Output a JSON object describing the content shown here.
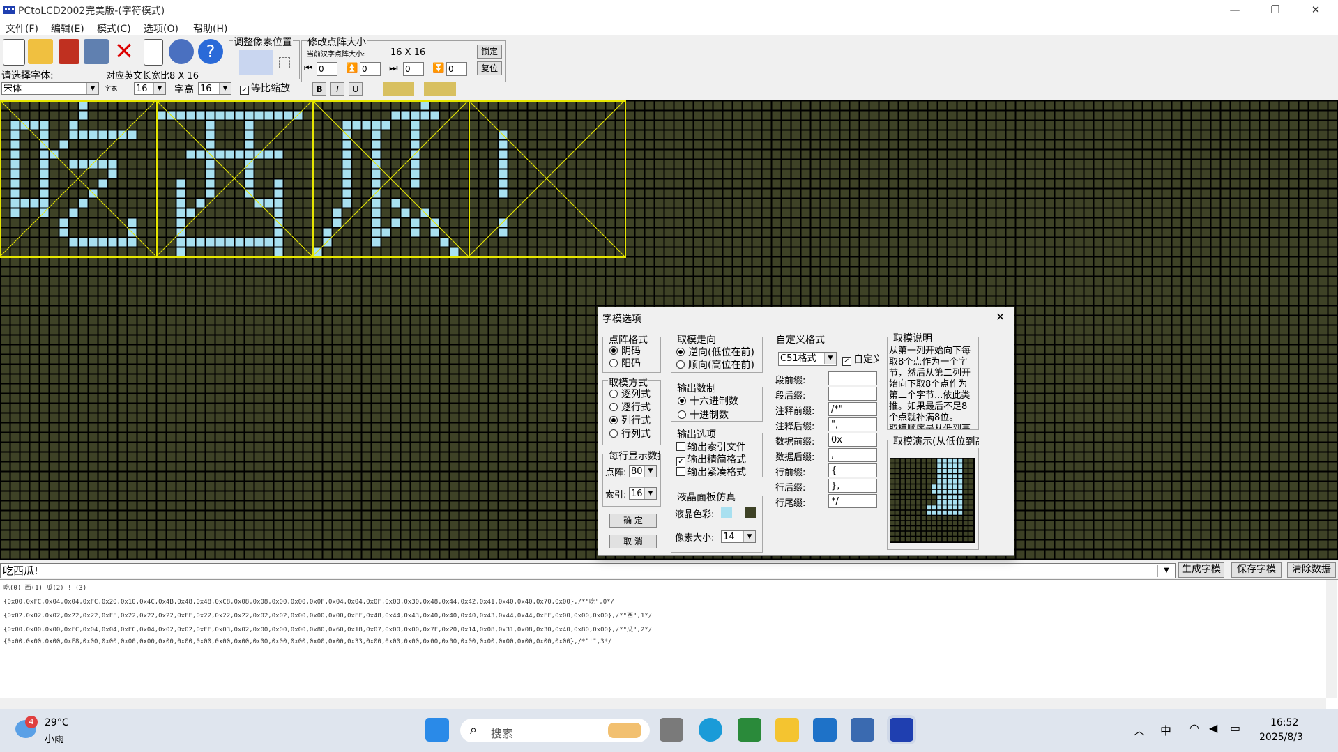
{
  "window": {
    "title": "PCtoLCD2002完美版-(字符模式)",
    "minimize": "—",
    "maximize": "❐",
    "close": "✕"
  },
  "menu": [
    "文件(F)",
    "编辑(E)",
    "模式(C)",
    "选项(O)",
    "帮助(H)"
  ],
  "toolbar": {
    "font_prompt": "请选择字体:",
    "font_value": "宋体",
    "ascii_ratio_label": "对应英文长宽比8 X 16",
    "width_label": "字宽",
    "width_value": "16",
    "height_label": "字高",
    "height_value": "16",
    "proportional_label": "等比缩放",
    "proportional_checked": true,
    "adjust_pixel_label": "调整像素位置",
    "resize_label": "修改点阵大小",
    "current_size_label": "当前汉字点阵大小:",
    "current_size_value": "16 X 16",
    "lock_button": "锁定",
    "reset_button": "复位",
    "spin_values": [
      "0",
      "0",
      "0",
      "0"
    ],
    "bold": "B",
    "italic": "I",
    "underline": "U"
  },
  "canvas": {
    "bg_color": "#3e4226",
    "grid_color": "#000000",
    "on_color": "#a8e0f0",
    "frame_color": "#e6e600"
  },
  "input_text": "吃西瓜!",
  "buttons": {
    "generate": "生成字模",
    "save": "保存字模",
    "clear": "清除数据"
  },
  "output": {
    "header": "吃(0) 西(1) 瓜(2) ! (3)",
    "lines": [
      "{0x00,0xFC,0x04,0x04,0xFC,0x20,0x10,0x4C,0x4B,0x48,0x48,0xC8,0x08,0x08,0x00,0x00,0x0F,0x04,0x04,0x0F,0x00,0x30,0x48,0x44,0x42,0x41,0x40,0x40,0x70,0x00},/*\"吃\",0*/",
      "{0x02,0x02,0x02,0x22,0x22,0xFE,0x22,0x22,0x22,0xFE,0x22,0x22,0x22,0x02,0x02,0x00,0x00,0x00,0xFF,0x48,0x44,0x43,0x40,0x40,0x40,0x43,0x44,0x44,0xFF,0x00,0x00,0x00},/*\"西\",1*/",
      "{0x00,0x00,0x00,0xFC,0x04,0x04,0xFC,0x04,0x02,0x02,0xFE,0x03,0x02,0x00,0x00,0x00,0x80,0x60,0x18,0x07,0x00,0x00,0x7F,0x20,0x14,0x08,0x31,0x08,0x30,0x40,0x80,0x00},/*\"瓜\",2*/",
      "{0x00,0x00,0x00,0xF8,0x00,0x00,0x00,0x00,0x00,0x00,0x00,0x00,0x00,0x00,0x00,0x00,0x00,0x00,0x33,0x00,0x00,0x00,0x00,0x00,0x00,0x00,0x00,0x00,0x00,0x00},/*\"!\",3*/"
    ]
  },
  "dialog": {
    "title": "字模选项",
    "dot_format": {
      "label": "点阵格式",
      "options": [
        "阴码",
        "阳码"
      ],
      "selected": 0
    },
    "scan_mode": {
      "label": "取模方式",
      "options": [
        "逐列式",
        "逐行式",
        "列行式",
        "行列式"
      ],
      "selected": 2
    },
    "per_line": {
      "label": "每行显示数据",
      "dot_label": "点阵:",
      "dot_value": "80",
      "index_label": "索引:",
      "index_value": "16"
    },
    "scan_dir": {
      "label": "取模走向",
      "options": [
        "逆向(低位在前)",
        "顺向(高位在前)"
      ],
      "selected": 0
    },
    "num_format": {
      "label": "输出数制",
      "options": [
        "十六进制数",
        "十进制数"
      ],
      "selected": 0
    },
    "out_options": {
      "label": "输出选项",
      "options": [
        "输出索引文件",
        "输出精简格式",
        "输出紧凑格式"
      ],
      "checked": [
        false,
        true,
        false
      ]
    },
    "lcd_sim": {
      "label": "液晶面板仿真",
      "color_label": "液晶色彩:",
      "on_color": "#a8e0f0",
      "off_color": "#3e4226",
      "pixel_label": "像素大小:",
      "pixel_value": "14"
    },
    "ok": "确  定",
    "cancel": "取  消",
    "custom": {
      "label": "自定义格式",
      "format_value": "C51格式",
      "custom_check": "自定义格式",
      "custom_checked": true,
      "fields": [
        {
          "label": "段前缀:",
          "value": ""
        },
        {
          "label": "段后缀:",
          "value": ""
        },
        {
          "label": "注释前缀:",
          "value": "/*\""
        },
        {
          "label": "注释后缀:",
          "value": "\","
        },
        {
          "label": "数据前缀:",
          "value": "0x"
        },
        {
          "label": "数据后缀:",
          "value": ","
        },
        {
          "label": "行前缀:",
          "value": "{"
        },
        {
          "label": "行后缀:",
          "value": "},"
        },
        {
          "label": "行尾缀:",
          "value": "*/"
        }
      ]
    },
    "explain": {
      "label": "取模说明",
      "text": "从第一列开始向下每取8个点作为一个字节，然后从第二列开始向下取8个点作为第二个字节...依此类推。如果最后不足8个点就补满8位。\n取模顺序是从低到高"
    },
    "demo": {
      "label": "取模演示(从低位到高位)"
    }
  },
  "taskbar": {
    "weather_temp": "29°C",
    "weather_desc": "小雨",
    "weather_badge": "4",
    "search_placeholder": "搜索",
    "ime": "中",
    "time": "16:52",
    "date": "2025/8/3"
  }
}
